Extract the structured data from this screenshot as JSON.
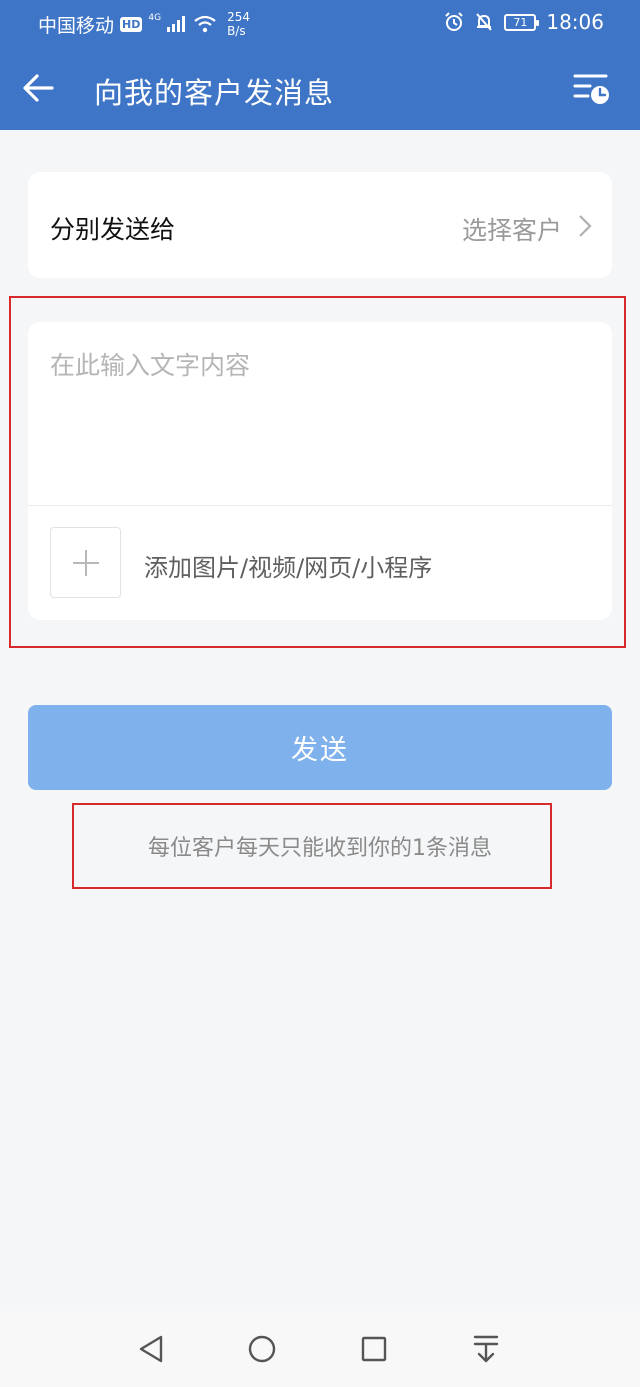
{
  "status_bar": {
    "carrier": "中国移动",
    "hd_badge": "HD",
    "network": "4G",
    "speed_value": "254",
    "speed_unit": "B/s",
    "battery": "71",
    "time": "18:06"
  },
  "header": {
    "title": "向我的客户发消息",
    "background_color": "#3f75c6"
  },
  "recipient": {
    "label": "分别发送给",
    "select_text": "选择客户"
  },
  "compose": {
    "placeholder": "在此输入文字内容",
    "value": "",
    "attach_label": "添加图片/视频/网页/小程序"
  },
  "send_button": {
    "label": "发送",
    "color": "#7fb1ec"
  },
  "notice": "每位客户每天只能收到你的1条消息",
  "highlight_color": "#d82a2a"
}
